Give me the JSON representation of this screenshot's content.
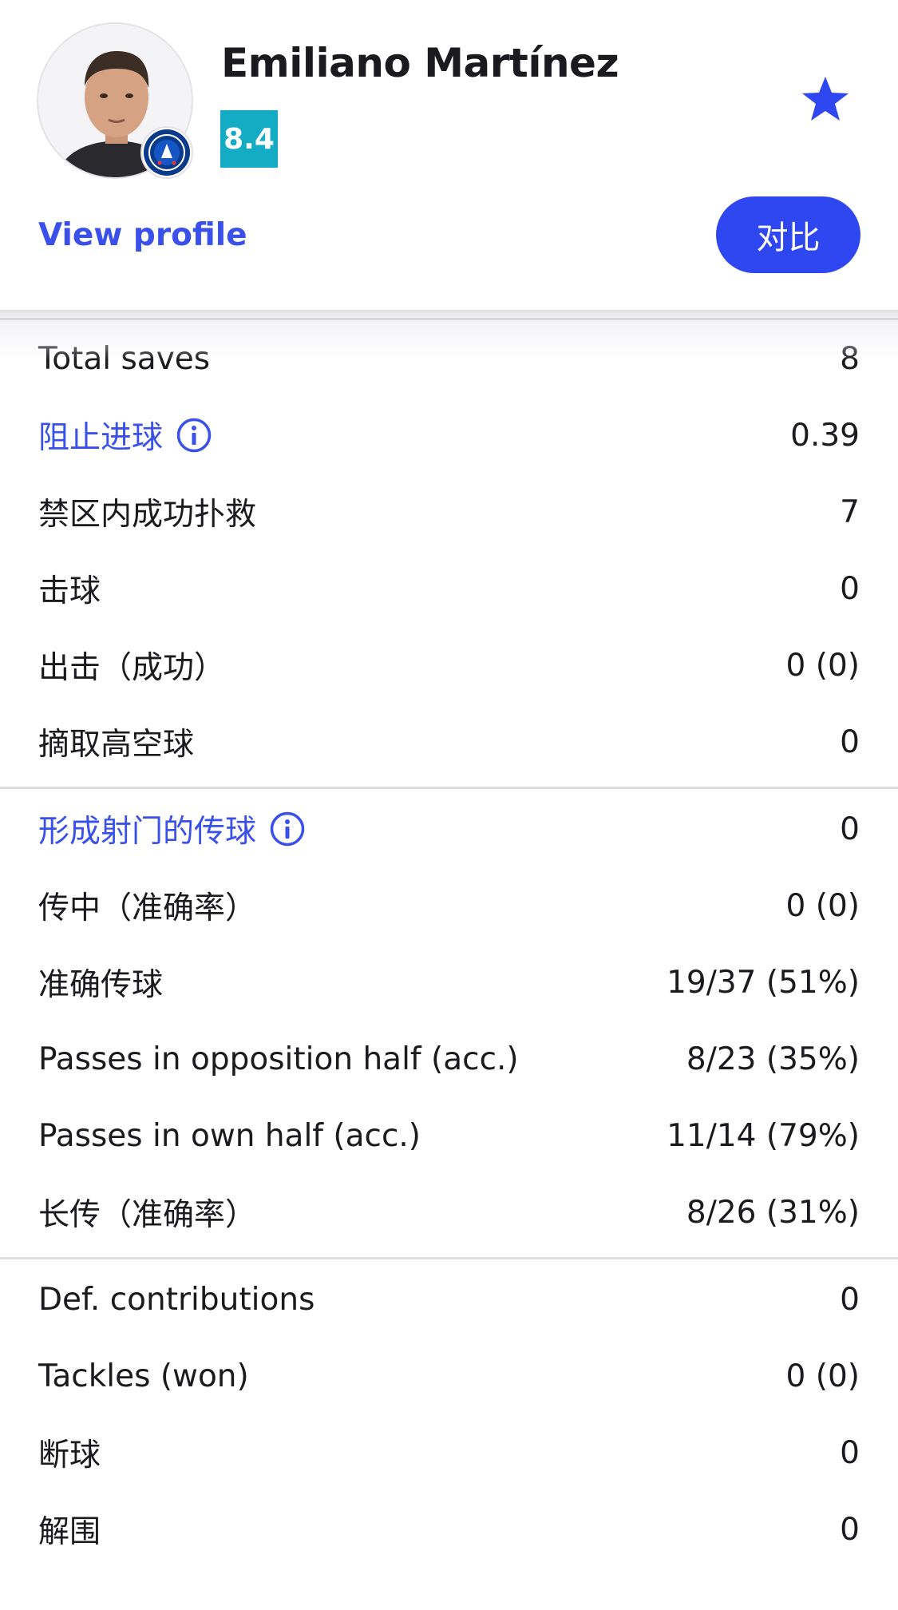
{
  "player": {
    "name": "Emiliano Martínez",
    "rating": "8.4",
    "club_badge": "chelsea-crest",
    "view_profile_label": "View profile",
    "compare_label": "对比",
    "favorite_icon": "star-icon"
  },
  "colors": {
    "accent": "#2f47f0",
    "link": "#3a50ea",
    "rating_bg": "#14abc5"
  },
  "stat_groups": [
    {
      "rows": [
        {
          "label": "Total saves",
          "value": "8",
          "link": false,
          "info": false
        },
        {
          "label": "阻止进球",
          "value": "0.39",
          "link": true,
          "info": true
        },
        {
          "label": "禁区内成功扑救",
          "value": "7",
          "link": false,
          "info": false
        },
        {
          "label": "击球",
          "value": "0",
          "link": false,
          "info": false
        },
        {
          "label": "出击（成功）",
          "value": "0 (0)",
          "link": false,
          "info": false
        },
        {
          "label": "摘取高空球",
          "value": "0",
          "link": false,
          "info": false
        }
      ]
    },
    {
      "rows": [
        {
          "label": "形成射门的传球",
          "value": "0",
          "link": true,
          "info": true
        },
        {
          "label": "传中（准确率）",
          "value": "0 (0)",
          "link": false,
          "info": false
        },
        {
          "label": "准确传球",
          "value": "19/37 (51%)",
          "link": false,
          "info": false
        },
        {
          "label": "Passes in opposition half (acc.)",
          "value": "8/23 (35%)",
          "link": false,
          "info": false
        },
        {
          "label": "Passes in own half (acc.)",
          "value": "11/14 (79%)",
          "link": false,
          "info": false
        },
        {
          "label": "长传（准确率）",
          "value": "8/26 (31%)",
          "link": false,
          "info": false
        }
      ]
    },
    {
      "rows": [
        {
          "label": "Def. contributions",
          "value": "0",
          "link": false,
          "info": false
        },
        {
          "label": "Tackles (won)",
          "value": "0 (0)",
          "link": false,
          "info": false
        },
        {
          "label": "断球",
          "value": "0",
          "link": false,
          "info": false
        },
        {
          "label": "解围",
          "value": "0",
          "link": false,
          "info": false
        }
      ]
    }
  ]
}
